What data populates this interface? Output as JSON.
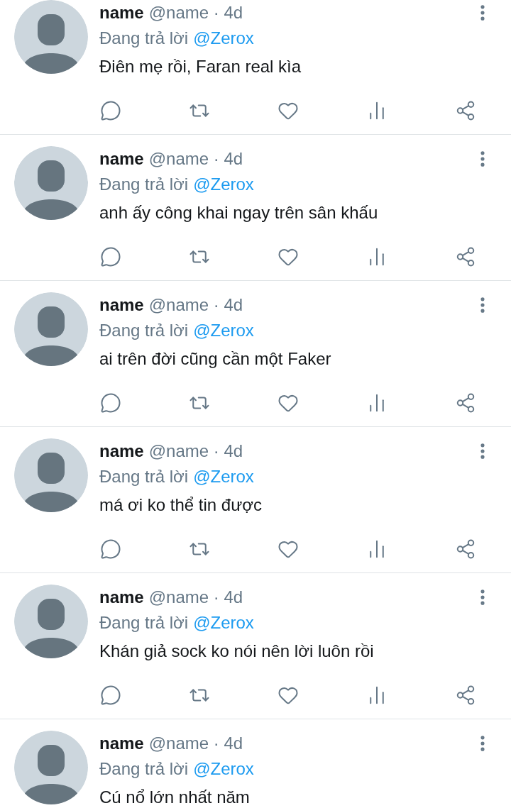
{
  "replies": [
    {
      "name": "name",
      "handle": "@name · 4d",
      "reply_prefix": "Đang trả lời",
      "reply_to": "@Zerox",
      "text": "Điên mẹ rồi, Faran real kìa",
      "actions_visible": true
    },
    {
      "name": "name",
      "handle": "@name · 4d",
      "reply_prefix": "Đang trả lời",
      "reply_to": "@Zerox",
      "text": "anh ấy công khai ngay trên sân khấu",
      "actions_visible": true
    },
    {
      "name": "name",
      "handle": "@name · 4d",
      "reply_prefix": "Đang trả lời",
      "reply_to": "@Zerox",
      "text": "ai trên đời cũng cần một Faker",
      "actions_visible": true
    },
    {
      "name": "name",
      "handle": "@name · 4d",
      "reply_prefix": "Đang trả lời",
      "reply_to": "@Zerox",
      "text": "má ơi ko thể tin được",
      "actions_visible": true
    },
    {
      "name": "name",
      "handle": "@name · 4d",
      "reply_prefix": "Đang trả lời",
      "reply_to": "@Zerox",
      "text": "Khán giả sock ko nói nên lời luôn rồi",
      "actions_visible": true
    },
    {
      "name": "name",
      "handle": "@name · 4d",
      "reply_prefix": "Đang trả lời",
      "reply_to": "@Zerox",
      "text": "Cú nổ lớn nhất năm",
      "actions_visible": false
    }
  ]
}
